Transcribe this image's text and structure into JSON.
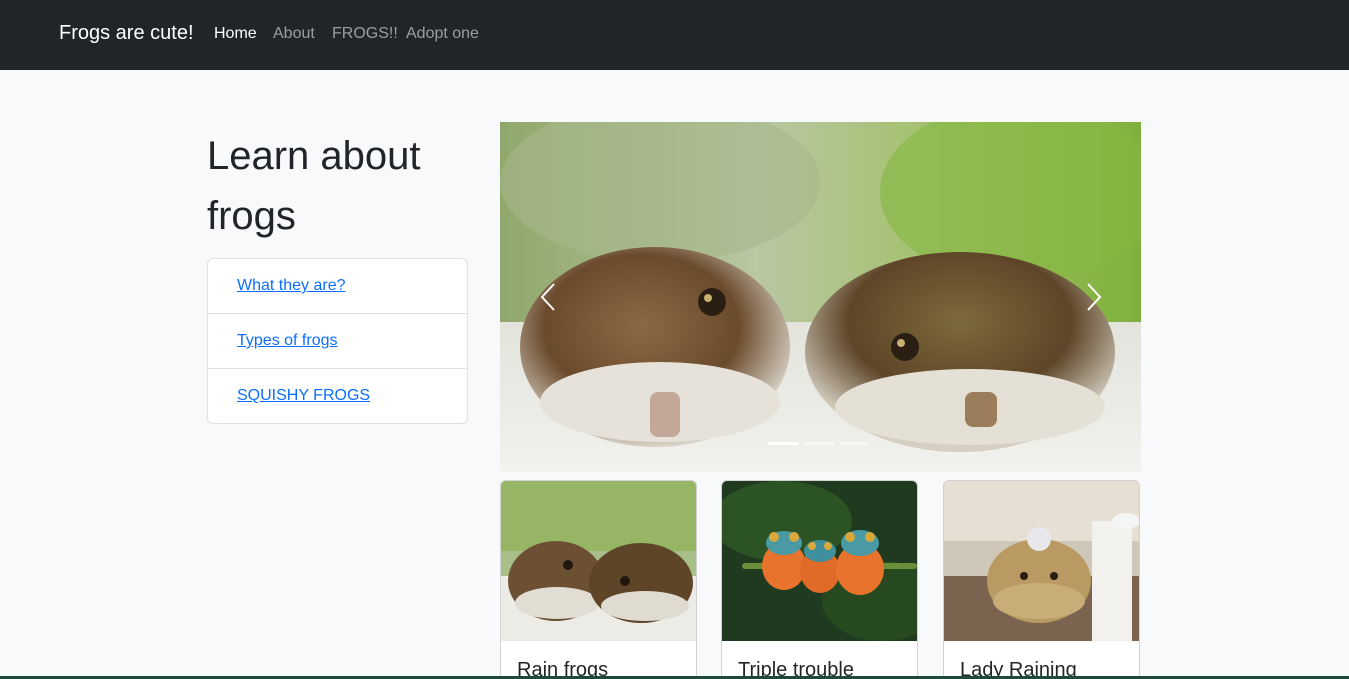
{
  "navbar": {
    "brand": "Frogs are cute!",
    "links": [
      {
        "label": "Home",
        "active": true
      },
      {
        "label": "About",
        "active": false
      },
      {
        "label": "FROGS!!",
        "active": false
      },
      {
        "label": "Adopt one",
        "active": false
      }
    ]
  },
  "sidebar": {
    "heading": "Learn about frogs",
    "links": [
      "What they are?",
      "Types of frogs",
      "SQUISHY FROGS"
    ]
  },
  "carousel": {
    "slide_count": 3,
    "active_slide": 1,
    "prev_icon": "chevron-left-icon",
    "next_icon": "chevron-right-icon"
  },
  "cards": [
    {
      "title": "Rain frogs"
    },
    {
      "title": "Triple trouble"
    },
    {
      "title": "Lady Raining"
    }
  ],
  "colors": {
    "navbar_bg": "#212529",
    "page_bg": "#f8f9fa",
    "link": "#0d6efd"
  }
}
